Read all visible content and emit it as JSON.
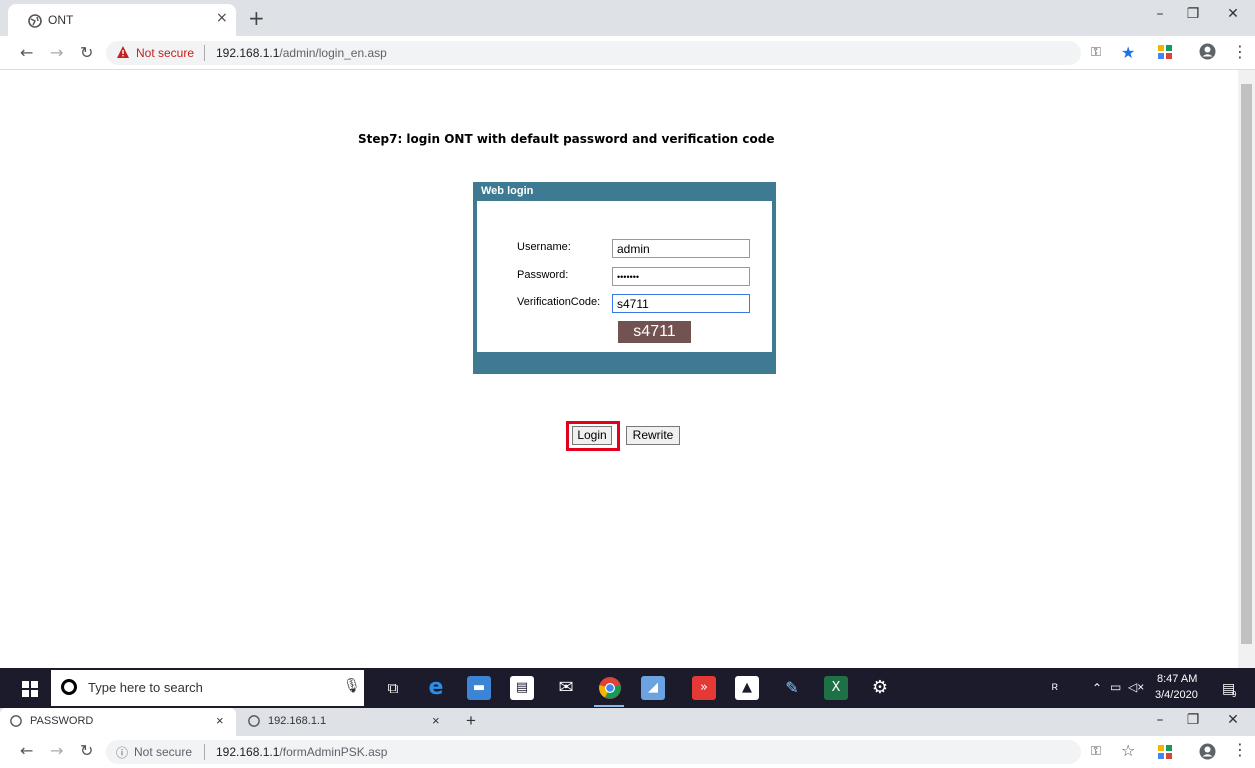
{
  "browser_top": {
    "tab_title": "ONT",
    "tab_close": "×",
    "new_tab": "+",
    "security_label": "Not secure",
    "url_host": "192.168.1.1",
    "url_path": "/admin/login_en.asp",
    "win_minimize": "–",
    "win_restore": "❐",
    "win_close": "✕"
  },
  "page": {
    "caption": "Step7: login ONT with default password and verification code",
    "login_title": "Web login",
    "username_label": "Username:",
    "username_value": "admin",
    "password_label": "Password:",
    "password_value": "•••••••",
    "verification_label": "VerificationCode:",
    "verification_value": "s4711",
    "captcha_text": "s4711",
    "login_button": "Login",
    "rewrite_button": "Rewrite"
  },
  "taskbar": {
    "search_placeholder": "Type here to search",
    "time": "8:47 AM",
    "date": "3/4/2020",
    "notification_count": "9"
  },
  "browser_bottom": {
    "tab1_title": "PASSWORD",
    "tab2_title": "192.168.1.1",
    "tab_close": "×",
    "new_tab": "+",
    "security_label": "Not secure",
    "url_host": "192.168.1.1",
    "url_path": "/formAdminPSK.asp"
  },
  "colors": {
    "login_header": "#3e7a92",
    "captcha_bg": "#735352",
    "highlight": "#e3001b",
    "taskbar": "#1b1b2b"
  }
}
